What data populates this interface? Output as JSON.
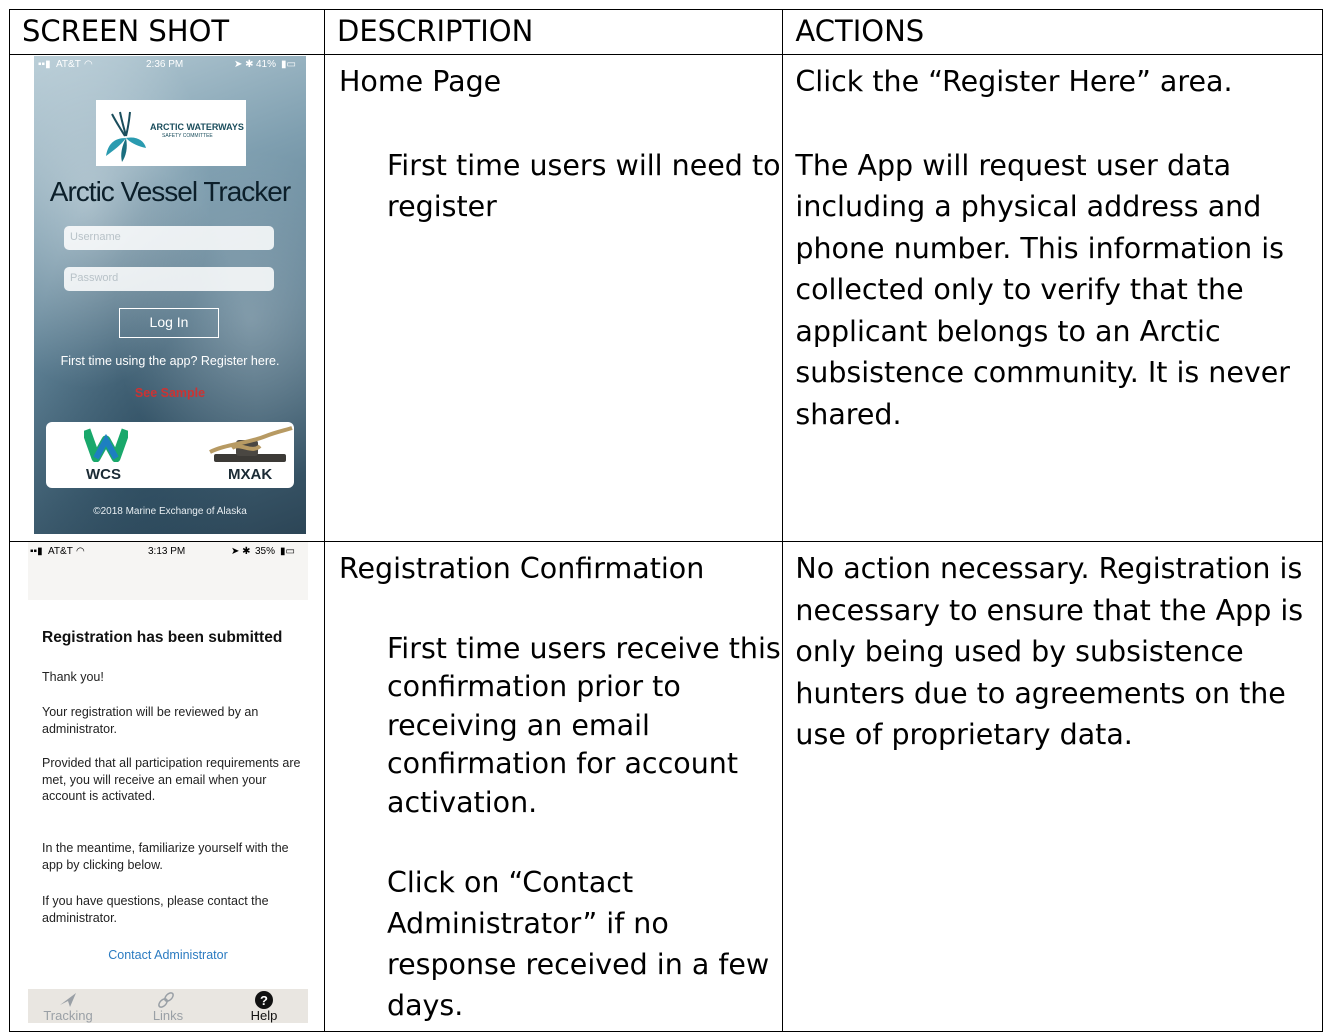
{
  "headers": {
    "screenshot": "SCREEN SHOT",
    "description": "DESCRIPTION",
    "actions": "ACTIONS"
  },
  "rows": [
    {
      "description_title": "Home Page",
      "description_body": "First time users will need to register",
      "actions_line1": "Click the “Register Here” area.",
      "actions_line2": "The App will request user data including a physical address and phone number. This information is collected only to verify that the applicant belongs to an Arctic subsistence community. It is never shared.",
      "phone": {
        "carrier": "AT&T",
        "time": "2:36 PM",
        "battery": "41%",
        "logo_line1": "ARCTIC WATERWAYS",
        "logo_line2": "SAFETY COMMITTEE",
        "app_title": "Arctic Vessel Tracker",
        "username_placeholder": "Username",
        "password_placeholder": "Password",
        "login_label": "Log In",
        "register_text": "First time using the app? Register here.",
        "sample_text": "See Sample",
        "sponsor1": "WCS",
        "sponsor2": "MXAK",
        "copyright": "©2018 Marine Exchange of Alaska"
      }
    },
    {
      "description_title": "Registration Confirmation",
      "description_body1": "First time users receive this confirmation prior to receiving an email confirmation for account activation.",
      "description_body2": "Click on “Contact Administrator” if no response received in a few days.",
      "actions_text": "No action necessary. Registration is necessary to ensure that the App is only being used by subsistence hunters due to agreements on the use of proprietary data.",
      "phone": {
        "carrier": "AT&T",
        "time": "3:13 PM",
        "battery": "35%",
        "heading": "Registration has been submitted",
        "thanks": "Thank you!",
        "p1": "Your registration will be reviewed by an administrator.",
        "p2": "Provided that all participation requirements are met, you will receive an email when your account is activated.",
        "p3": "In the meantime, familiarize yourself with the app by clicking below.",
        "p4": "If you have questions, please contact the administrator.",
        "contact_link": "Contact Administrator",
        "tabs": [
          "Tracking",
          "Links",
          "Help"
        ]
      }
    }
  ]
}
